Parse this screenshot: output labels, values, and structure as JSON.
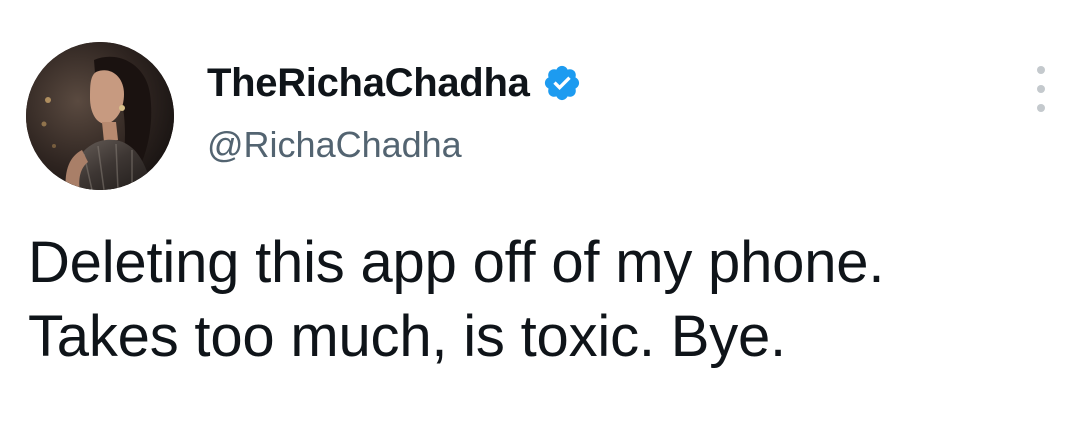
{
  "tweet": {
    "display_name": "TheRichaChadha",
    "verified": true,
    "handle": "@RichaChadha",
    "text_line_1": "Deleting this app off of my phone.",
    "text_line_2": "Takes too much, is toxic. Bye."
  },
  "icons": {
    "verified": "verified-badge-icon",
    "more": "more-options-icon"
  },
  "colors": {
    "name": "#0f1419",
    "handle": "#536471",
    "verified_badge": "#1d9bf0",
    "more_dots": "#c4c9cd"
  }
}
